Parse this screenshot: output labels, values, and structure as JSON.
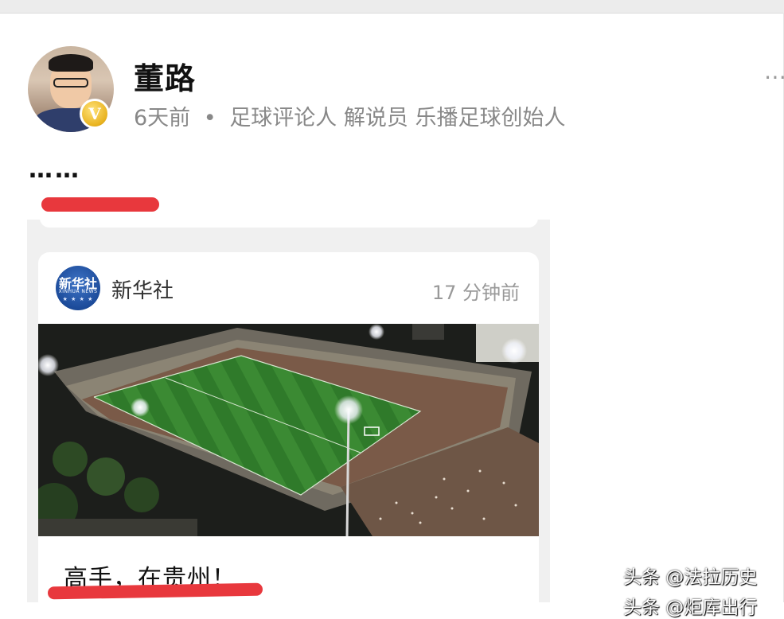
{
  "post": {
    "author": "董路",
    "time": "6天前",
    "separator": "•",
    "bio": "足球评论人 解说员 乐播足球创始人",
    "verified_badge": "V",
    "more_icon": "⋯",
    "body_text": "……"
  },
  "embedded_news": {
    "source_logo_text": "新华社",
    "source_logo_en": "XINHUA NEWS",
    "source_name": "新华社",
    "time_ago": "17 分钟前",
    "caption": "高手，在贵州！"
  },
  "watermark": {
    "line1": "头条 @法拉历史",
    "line2": "头条 @炬库出行"
  },
  "colors": {
    "highlight_red": "#e8383d",
    "meta_gray": "#888888",
    "field_green": "#2f7a2a"
  }
}
